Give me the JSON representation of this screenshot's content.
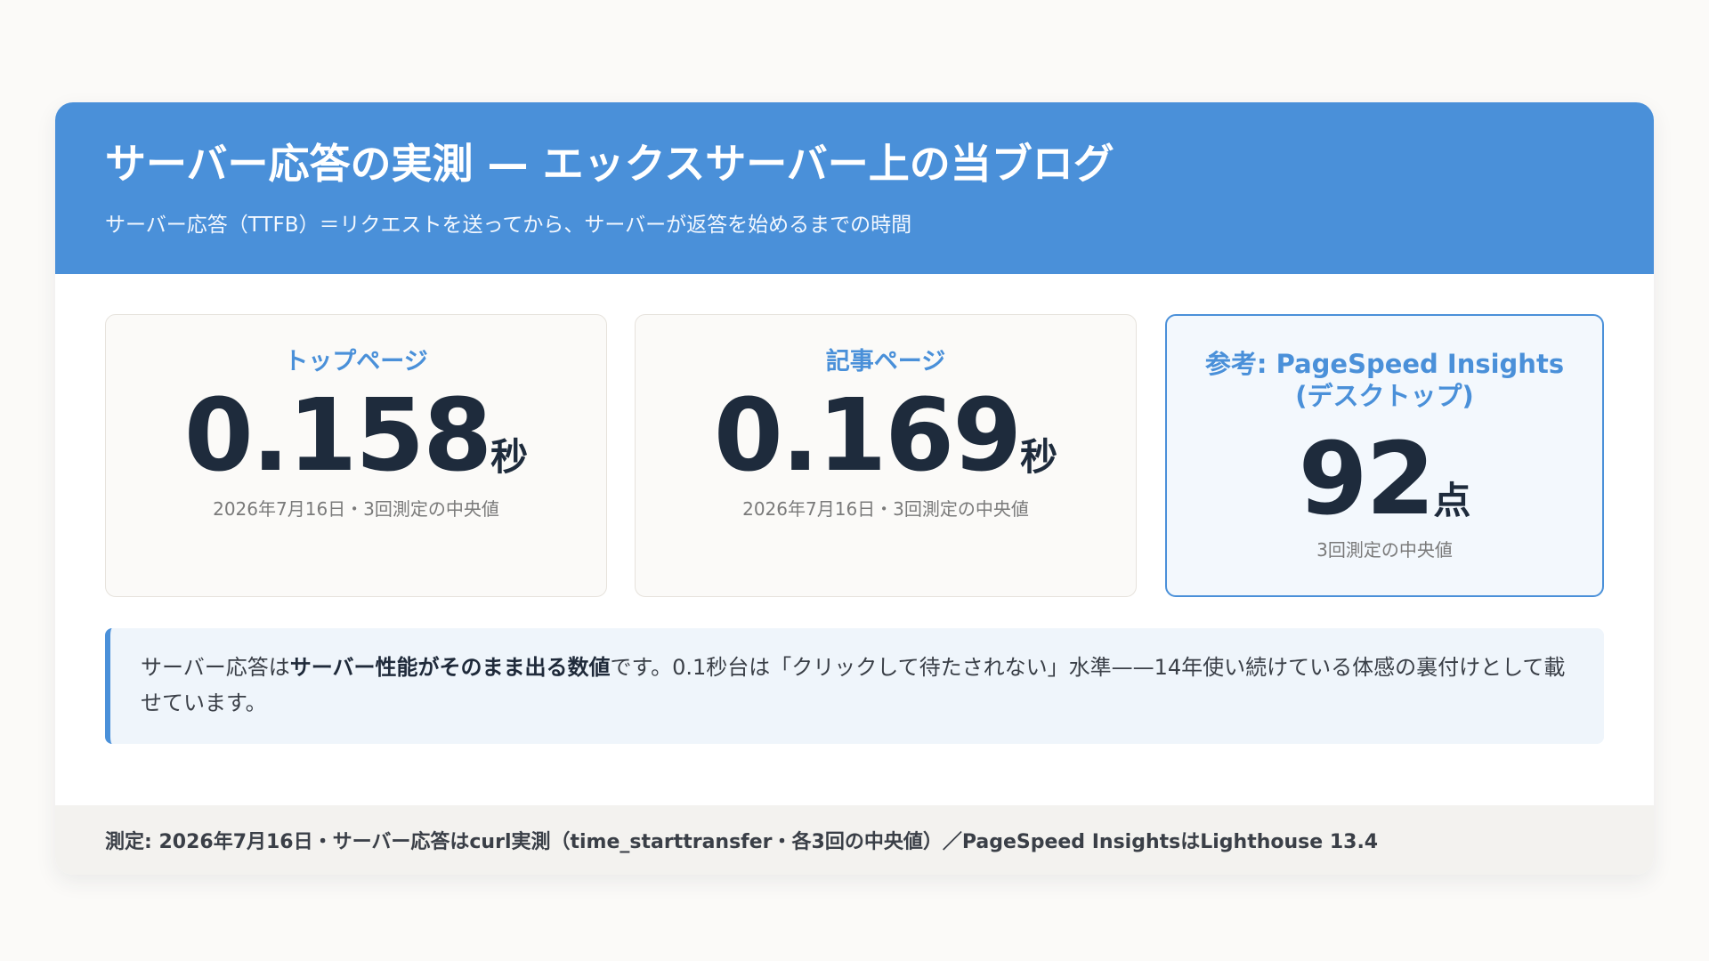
{
  "header": {
    "title": "サーバー応答の実測 — エックスサーバー上の当ブログ",
    "subtitle": "サーバー応答（TTFB）＝リクエストを送ってから、サーバーが返答を始めるまでの時間"
  },
  "metrics": [
    {
      "label": "トップページ",
      "value": "0.158",
      "unit": "秒",
      "note": "2026年7月16日・3回測定の中央値"
    },
    {
      "label": "記事ページ",
      "value": "0.169",
      "unit": "秒",
      "note": "2026年7月16日・3回測定の中央値"
    },
    {
      "label_line1": "参考: PageSpeed Insights",
      "label_line2": "(デスクトップ)",
      "value": "92",
      "unit": "点",
      "note": "3回測定の中央値"
    }
  ],
  "callout": {
    "text_before": "サーバー応答は",
    "text_bold": "サーバー性能がそのまま出る数値",
    "text_after": "です。0.1秒台は「クリックして待たされない」水準——14年使い続けている体感の裏付けとして載せています。"
  },
  "footer": {
    "text": "測定: 2026年7月16日・サーバー応答はcurl実測（time_starttransfer・各3回の中央値）／PageSpeed InsightsはLighthouse 13.4"
  },
  "colors": {
    "accent": "#4a90d9",
    "background": "#fbfaf8",
    "text_dark": "#1e2b3c"
  }
}
